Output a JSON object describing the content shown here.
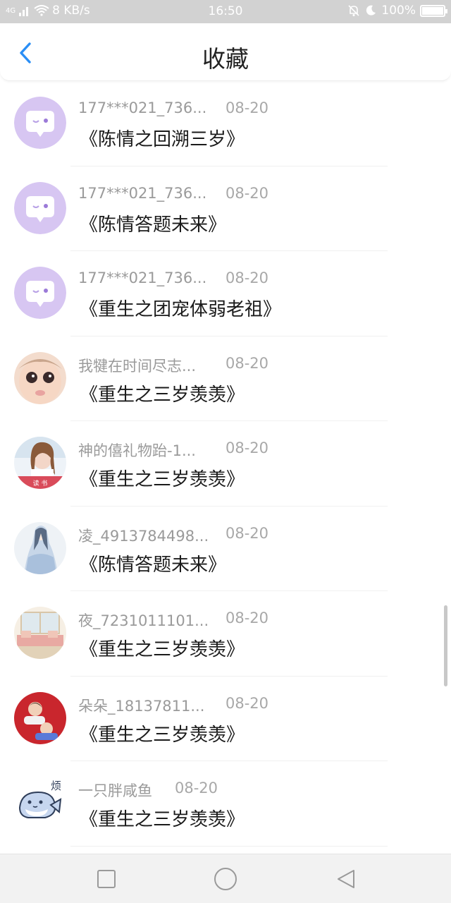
{
  "status_bar": {
    "network": "4G",
    "speed": "8 KB/s",
    "time": "16:50",
    "battery": "100%"
  },
  "header": {
    "title": "收藏",
    "back_icon": "chevron-left-icon",
    "accent_color": "#2a8ef5"
  },
  "favorites": [
    {
      "user": "177***021_736...",
      "date": "08-20",
      "book": "《陈情之回溯三岁》",
      "avatar": "purple-chat-bubble"
    },
    {
      "user": "177***021_736...",
      "date": "08-20",
      "book": "《陈情答题未来》",
      "avatar": "purple-chat-bubble"
    },
    {
      "user": "177***021_736...",
      "date": "08-20",
      "book": "《重生之团宠体弱老祖》",
      "avatar": "purple-chat-bubble"
    },
    {
      "user": "我犍在时间尽志...",
      "date": "08-20",
      "book": "《重生之三岁羡羡》",
      "avatar": "baby-photo"
    },
    {
      "user": "神的僖礼物跆-1...",
      "date": "08-20",
      "book": "《重生之三岁羡羡》",
      "avatar": "girl-photo"
    },
    {
      "user": "凌_4913784498...",
      "date": "08-20",
      "book": "《陈情答题未来》",
      "avatar": "anime-character"
    },
    {
      "user": "夜_7231011101...",
      "date": "08-20",
      "book": "《重生之三岁羡羡》",
      "avatar": "room-photo"
    },
    {
      "user": "朵朵_18137811...",
      "date": "08-20",
      "book": "《重生之三岁羡羡》",
      "avatar": "children-photo"
    },
    {
      "user": "一只胖咸鱼",
      "date": "08-20",
      "book": "《重生之三岁羡羡》",
      "avatar": "cartoon-fish",
      "avatar_label": "烦"
    }
  ],
  "nav_bar": {
    "recent_icon": "square-icon",
    "home_icon": "circle-icon",
    "back_icon": "triangle-back-icon"
  }
}
